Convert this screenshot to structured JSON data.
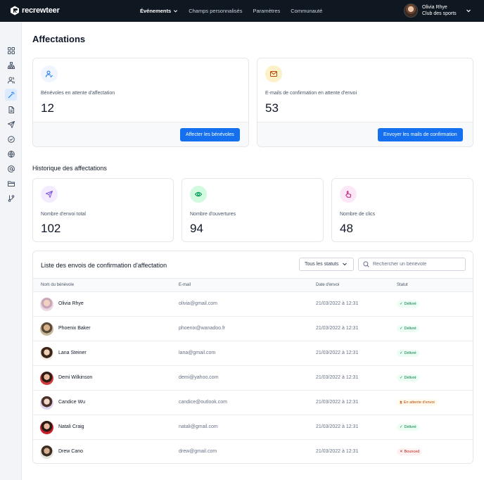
{
  "app": {
    "brand": "recrewteer"
  },
  "nav": [
    {
      "label": "Événements",
      "active": true,
      "has_dropdown": true
    },
    {
      "label": "Champs personnalisés",
      "active": false
    },
    {
      "label": "Paramètres",
      "active": false
    },
    {
      "label": "Communauté",
      "active": false
    }
  ],
  "user": {
    "name": "Olivia Rhye",
    "club": "Club des sports"
  },
  "sidebar": {
    "items": [
      "grid-icon",
      "org-chart-icon",
      "users-icon",
      "magic-wand-icon",
      "file-icon",
      "send-icon",
      "check-circle-icon",
      "globe-icon",
      "at-sign-icon",
      "folder-icon",
      "git-branch-icon"
    ],
    "active_index": 3
  },
  "page": {
    "title": "Affectations"
  },
  "cards": {
    "pending_volunteers": {
      "label": "Bénévoles en attente d'affectation",
      "value": "12",
      "button": "Affecter les bénévoles"
    },
    "pending_emails": {
      "label": "E-mails de confirmation en attente d'envoi",
      "value": "53",
      "button": "Envoyer les mails de confirmation"
    }
  },
  "history": {
    "title": "Historique des affectations",
    "stats": [
      {
        "label": "Nombre d'envoi total",
        "value": "102",
        "icon": "send-icon"
      },
      {
        "label": "Nombre d'ouvertures",
        "value": "94",
        "icon": "eye-icon"
      },
      {
        "label": "Nombre de clics",
        "value": "48",
        "icon": "pointer-icon"
      }
    ]
  },
  "table": {
    "title": "Liste des envois de confirmation d'affectation",
    "status_filter": "Tous les statuts",
    "search_placeholder": "Rechercher un bénévole",
    "columns": [
      "Nom du bénévole",
      "E-mail",
      "Date d'envoi",
      "Statut"
    ],
    "rows": [
      {
        "name": "Olivia Rhye",
        "email": "olivia@gmail.com",
        "date": "21/03/2022 à 12:31",
        "status": "Délivré",
        "status_type": "ok"
      },
      {
        "name": "Phoenix Baker",
        "email": "phoenix@wanadoo.fr",
        "date": "21/03/2022 à 12:31",
        "status": "Délivré",
        "status_type": "ok"
      },
      {
        "name": "Lana Steiner",
        "email": "lana@gmail.com",
        "date": "21/03/2022 à 12:31",
        "status": "Délivré",
        "status_type": "ok"
      },
      {
        "name": "Demi Wilkinson",
        "email": "demi@yahoo.com",
        "date": "21/03/2022 à 12:31",
        "status": "Délivré",
        "status_type": "ok"
      },
      {
        "name": "Candice Wu",
        "email": "candice@outlook.com",
        "date": "21/03/2022 à 12:31",
        "status": "En attente d'envoi",
        "status_type": "wait"
      },
      {
        "name": "Natali Craig",
        "email": "natali@gmail.com",
        "date": "21/03/2022 à 12:31",
        "status": "Délivré",
        "status_type": "ok"
      },
      {
        "name": "Drew Cano",
        "email": "drew@gmail.com",
        "date": "21/03/2022 à 12:31",
        "status": "Bounced",
        "status_type": "bad"
      }
    ]
  },
  "colors": {
    "primary": "#1570ef",
    "topbar": "#0f1720",
    "success": "#027a48",
    "warning": "#b54708",
    "error": "#b42318"
  }
}
